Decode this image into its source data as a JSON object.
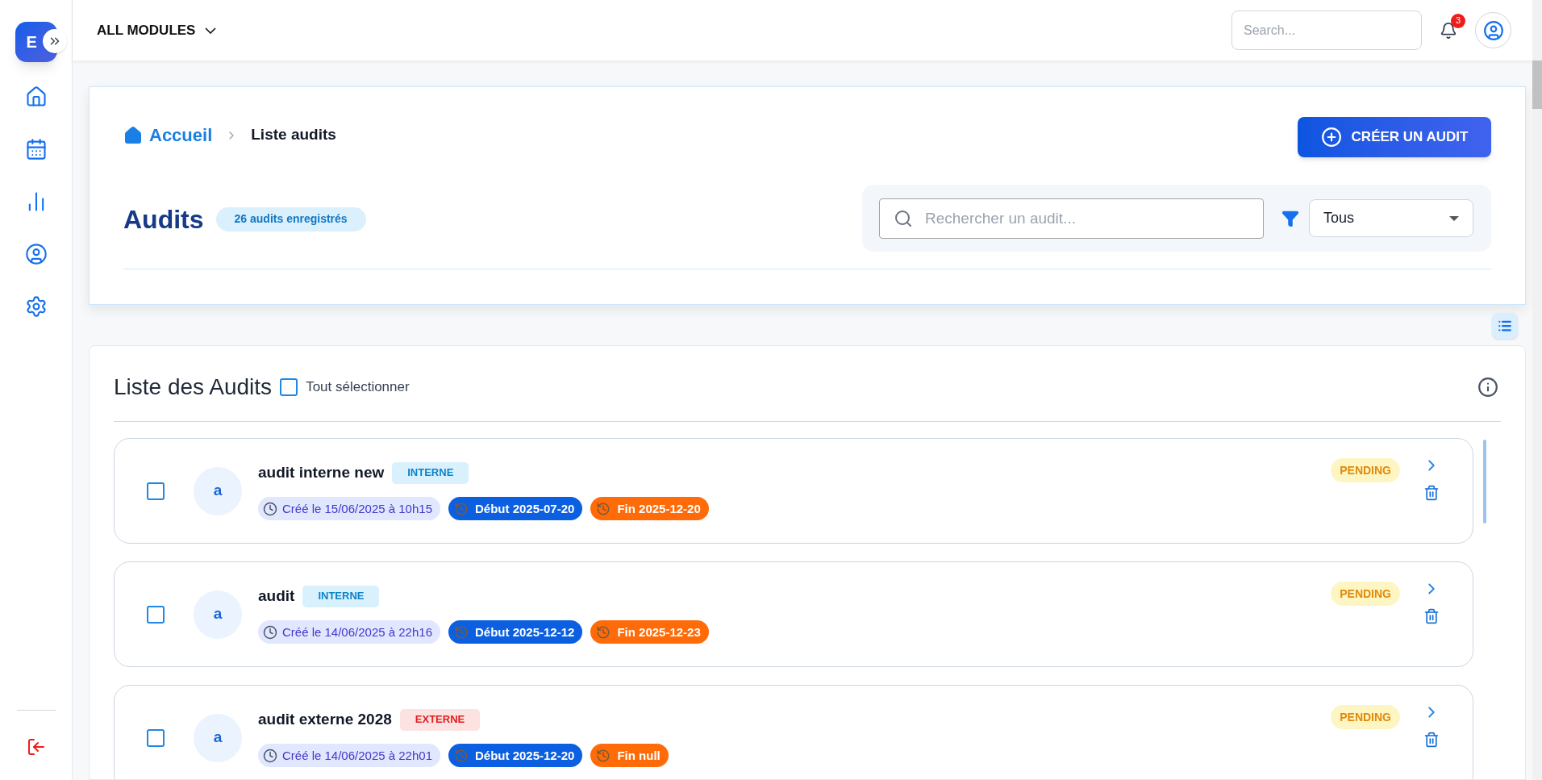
{
  "sidebar": {
    "logo": "E"
  },
  "header": {
    "module_menu": "ALL MODULES",
    "search": {
      "placeholder": "Search..."
    },
    "notifications": "3"
  },
  "breadcrumb": [
    "Accueil",
    "Liste audits"
  ],
  "create_button": "CRÉER UN AUDIT",
  "title": "Audits",
  "count_badge": "26 audits enregistrés",
  "filter": {
    "search_placeholder": "Rechercher un audit...",
    "select_value": "Tous"
  },
  "list": {
    "title": "Liste des Audits",
    "select_all": {
      "label": "Tout sélectionner",
      "checked": false
    },
    "rows": [
      {
        "checked": false,
        "avatar": "a",
        "name": "audit interne new",
        "type": {
          "label": "INTERNE",
          "kind": "internal"
        },
        "created": "Créé le 15/06/2025 à 10h15",
        "start": "Début 2025-07-20",
        "end": "Fin 2025-12-20",
        "status": "PENDING"
      },
      {
        "checked": false,
        "avatar": "a",
        "name": "audit",
        "type": {
          "label": "INTERNE",
          "kind": "internal"
        },
        "created": "Créé le 14/06/2025 à 22h16",
        "start": "Début 2025-12-12",
        "end": "Fin 2025-12-23",
        "status": "PENDING"
      },
      {
        "checked": false,
        "avatar": "a",
        "name": "audit externe 2028",
        "type": {
          "label": "EXTERNE",
          "kind": "external"
        },
        "created": "Créé le 14/06/2025 à 22h01",
        "start": "Début 2025-12-20",
        "end": "Fin null",
        "status": "PENDING"
      }
    ]
  }
}
